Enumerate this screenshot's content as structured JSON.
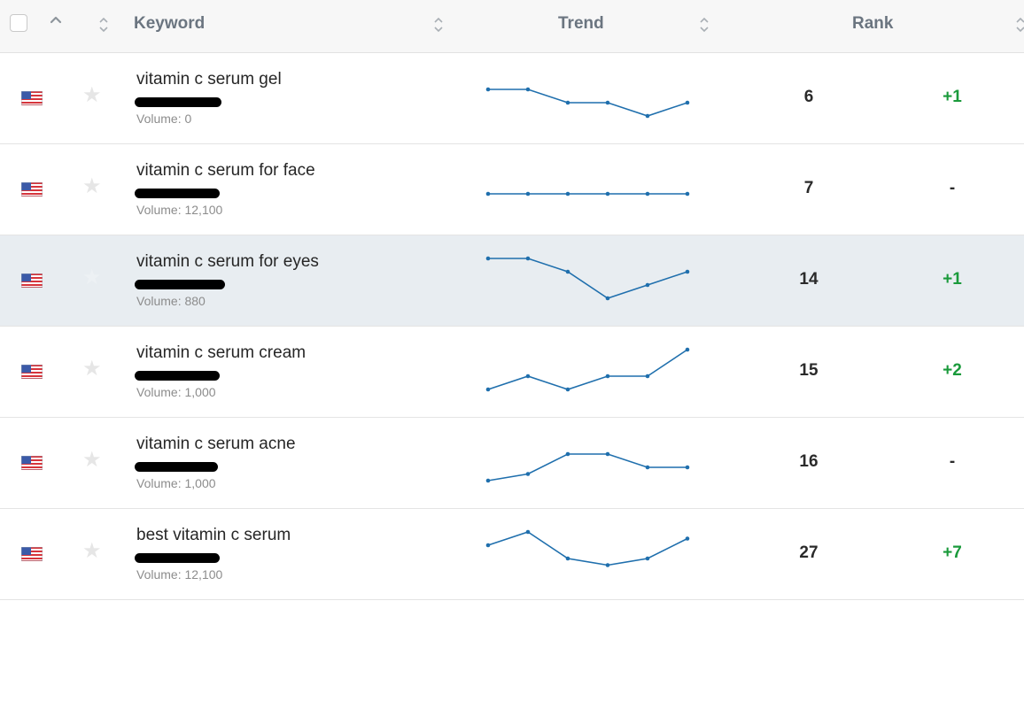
{
  "header": {
    "keyword_label": "Keyword",
    "trend_label": "Trend",
    "rank_label": "Rank"
  },
  "colors": {
    "trend_line": "#1f6fad",
    "positive_change": "#1a9a3b",
    "highlight_row": "#e8edf1"
  },
  "rows": [
    {
      "keyword": "vitamin c serum gel",
      "volume": "Volume: 0",
      "trend": [
        1,
        1,
        2,
        2,
        3,
        2
      ],
      "rank": "6",
      "change": "+1",
      "change_kind": "pos",
      "highlighted": false,
      "redacted": true
    },
    {
      "keyword": "vitamin c serum for face",
      "volume": "Volume: 12,100",
      "trend": [
        2,
        2,
        2,
        2,
        2,
        2
      ],
      "rank": "7",
      "change": "-",
      "change_kind": "none",
      "highlighted": false,
      "redacted": true
    },
    {
      "keyword": "vitamin c serum for eyes",
      "volume": "Volume: 880",
      "trend": [
        0,
        0,
        1,
        3,
        2,
        1
      ],
      "rank": "14",
      "change": "+1",
      "change_kind": "pos",
      "highlighted": true,
      "redacted": true
    },
    {
      "keyword": "vitamin c serum cream",
      "volume": "Volume: 1,000",
      "trend": [
        3,
        2,
        3,
        2,
        2,
        0
      ],
      "rank": "15",
      "change": "+2",
      "change_kind": "pos",
      "highlighted": false,
      "redacted": true
    },
    {
      "keyword": "vitamin c serum acne",
      "volume": "Volume: 1,000",
      "trend": [
        3,
        2.5,
        1,
        1,
        2,
        2
      ],
      "rank": "16",
      "change": "-",
      "change_kind": "none",
      "highlighted": false,
      "redacted": true
    },
    {
      "keyword": "best vitamin c serum",
      "volume": "Volume: 12,100",
      "trend": [
        1,
        0,
        2,
        2.5,
        2,
        0.5
      ],
      "rank": "27",
      "change": "+7",
      "change_kind": "pos",
      "highlighted": false,
      "redacted": true
    }
  ]
}
